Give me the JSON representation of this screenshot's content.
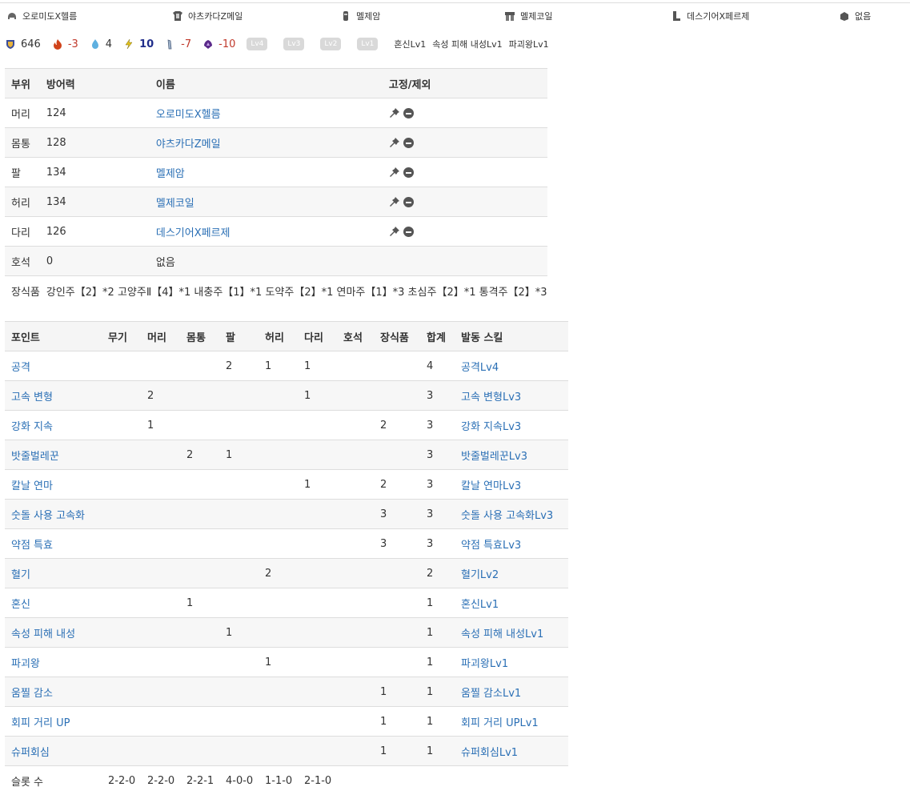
{
  "equipment": [
    {
      "name": "오로미도X헬름",
      "icon": "helmet-icon"
    },
    {
      "name": "야츠카다Z메일",
      "icon": "chest-armor-icon"
    },
    {
      "name": "멜제암",
      "icon": "arm-armor-icon"
    },
    {
      "name": "멜제코일",
      "icon": "waist-armor-icon"
    },
    {
      "name": "데스기어X페르제",
      "icon": "leg-armor-icon"
    },
    {
      "name": "없음",
      "icon": "charm-icon"
    }
  ],
  "stats": {
    "defense": "646",
    "fire": "-3",
    "water": "4",
    "thunder": "10",
    "ice": "-7",
    "dragon": "-10",
    "slot_badges": [
      "Lv4",
      "Lv3",
      "Lv2",
      "Lv1"
    ],
    "skill_summary": [
      "혼신Lv1",
      "속성 피해 내성Lv1",
      "파괴왕Lv1"
    ]
  },
  "armor_table": {
    "headers": {
      "part": "부위",
      "defense": "방어력",
      "name": "이름",
      "fix": "고정/제외"
    },
    "rows": [
      {
        "part": "머리",
        "defense": "124",
        "name": "오로미도X헬름"
      },
      {
        "part": "몸통",
        "defense": "128",
        "name": "야츠카다Z메일"
      },
      {
        "part": "팔",
        "defense": "134",
        "name": "멜제암"
      },
      {
        "part": "허리",
        "defense": "134",
        "name": "멜제코일"
      },
      {
        "part": "다리",
        "defense": "126",
        "name": "데스기어X페르제"
      },
      {
        "part": "호석",
        "defense": "0",
        "name": "없음"
      }
    ],
    "decorations_label": "장식품",
    "decorations": "강인주【2】*2 고양주Ⅱ【4】*1 내충주【1】*1 도약주【2】*1 연마주【1】*3 초심주【2】*1 통격주【2】*3"
  },
  "points_table": {
    "headers": [
      "포인트",
      "무기",
      "머리",
      "몸통",
      "팔",
      "허리",
      "다리",
      "호석",
      "장식품",
      "합계",
      "발동 스킬"
    ],
    "rows": [
      {
        "skill": "공격",
        "weapon": "",
        "head": "",
        "body": "",
        "arm": "2",
        "waist": "1",
        "leg": "1",
        "charm": "",
        "deco": "",
        "total": "4",
        "active": "공격Lv4"
      },
      {
        "skill": "고속 변형",
        "weapon": "",
        "head": "2",
        "body": "",
        "arm": "",
        "waist": "",
        "leg": "1",
        "charm": "",
        "deco": "",
        "total": "3",
        "active": "고속 변형Lv3"
      },
      {
        "skill": "강화 지속",
        "weapon": "",
        "head": "1",
        "body": "",
        "arm": "",
        "waist": "",
        "leg": "",
        "charm": "",
        "deco": "2",
        "total": "3",
        "active": "강화 지속Lv3"
      },
      {
        "skill": "밧줄벌레꾼",
        "weapon": "",
        "head": "",
        "body": "2",
        "arm": "1",
        "waist": "",
        "leg": "",
        "charm": "",
        "deco": "",
        "total": "3",
        "active": "밧줄벌레꾼Lv3"
      },
      {
        "skill": "칼날 연마",
        "weapon": "",
        "head": "",
        "body": "",
        "arm": "",
        "waist": "",
        "leg": "1",
        "charm": "",
        "deco": "2",
        "total": "3",
        "active": "칼날 연마Lv3"
      },
      {
        "skill": "숫돌 사용 고속화",
        "weapon": "",
        "head": "",
        "body": "",
        "arm": "",
        "waist": "",
        "leg": "",
        "charm": "",
        "deco": "3",
        "total": "3",
        "active": "숫돌 사용 고속화Lv3"
      },
      {
        "skill": "약점 특효",
        "weapon": "",
        "head": "",
        "body": "",
        "arm": "",
        "waist": "",
        "leg": "",
        "charm": "",
        "deco": "3",
        "total": "3",
        "active": "약점 특효Lv3"
      },
      {
        "skill": "혈기",
        "weapon": "",
        "head": "",
        "body": "",
        "arm": "",
        "waist": "2",
        "leg": "",
        "charm": "",
        "deco": "",
        "total": "2",
        "active": "혈기Lv2"
      },
      {
        "skill": "혼신",
        "weapon": "",
        "head": "",
        "body": "1",
        "arm": "",
        "waist": "",
        "leg": "",
        "charm": "",
        "deco": "",
        "total": "1",
        "active": "혼신Lv1"
      },
      {
        "skill": "속성 피해 내성",
        "weapon": "",
        "head": "",
        "body": "",
        "arm": "1",
        "waist": "",
        "leg": "",
        "charm": "",
        "deco": "",
        "total": "1",
        "active": "속성 피해 내성Lv1"
      },
      {
        "skill": "파괴왕",
        "weapon": "",
        "head": "",
        "body": "",
        "arm": "",
        "waist": "1",
        "leg": "",
        "charm": "",
        "deco": "",
        "total": "1",
        "active": "파괴왕Lv1"
      },
      {
        "skill": "움찔 감소",
        "weapon": "",
        "head": "",
        "body": "",
        "arm": "",
        "waist": "",
        "leg": "",
        "charm": "",
        "deco": "1",
        "total": "1",
        "active": "움찔 감소Lv1"
      },
      {
        "skill": "회피 거리 UP",
        "weapon": "",
        "head": "",
        "body": "",
        "arm": "",
        "waist": "",
        "leg": "",
        "charm": "",
        "deco": "1",
        "total": "1",
        "active": "회피 거리 UPLv1"
      },
      {
        "skill": "슈퍼회심",
        "weapon": "",
        "head": "",
        "body": "",
        "arm": "",
        "waist": "",
        "leg": "",
        "charm": "",
        "deco": "1",
        "total": "1",
        "active": "슈퍼회심Lv1"
      }
    ],
    "slots_label": "슬롯 수",
    "slots": [
      "2-2-0",
      "2-2-0",
      "2-2-1",
      "4-0-0",
      "1-1-0",
      "2-1-0"
    ]
  }
}
